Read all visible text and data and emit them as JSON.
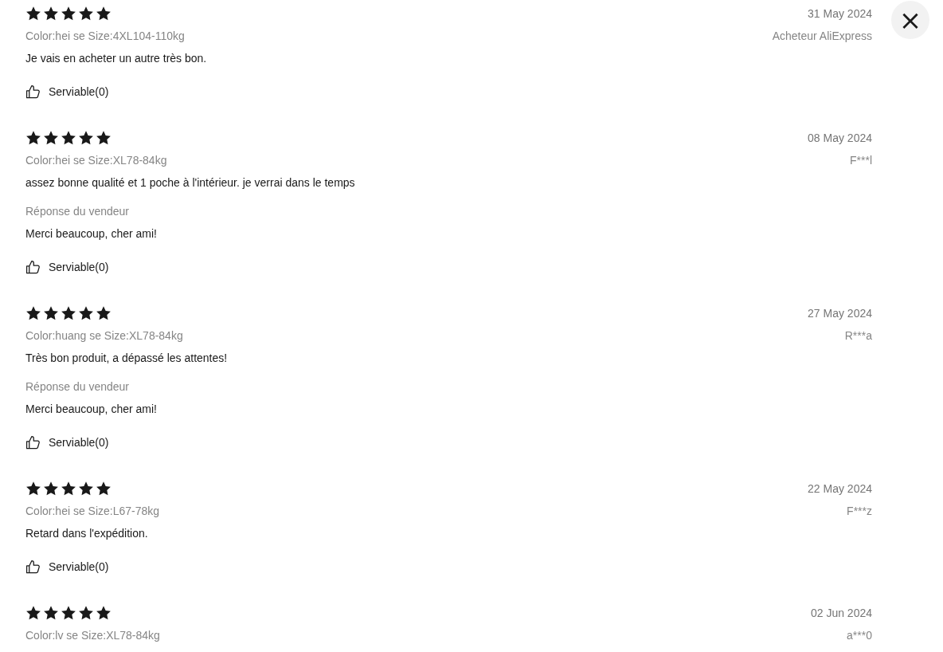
{
  "close_button": {
    "label": "×"
  },
  "reviews": [
    {
      "stars": 5,
      "date": "31 May 2024",
      "variant": "Color:hei se Size:4XL104-110kg",
      "author": "Acheteur AliExpress",
      "text": "Je vais en acheter un autre très bon.",
      "helpful": "Serviable(0)"
    },
    {
      "stars": 5,
      "date": "08 May 2024",
      "variant": "Color:hei se Size:XL78-84kg",
      "author": "F***l",
      "text": "assez bonne qualité et 1 poche à l'intérieur. je verrai dans le temps",
      "seller_reply": {
        "label": "Réponse du vendeur",
        "text": "Merci beaucoup, cher ami!"
      },
      "helpful": "Serviable(0)"
    },
    {
      "stars": 5,
      "date": "27 May 2024",
      "variant": "Color:huang se Size:XL78-84kg",
      "author": "R***a",
      "text": "Très bon produit, a dépassé les attentes!",
      "seller_reply": {
        "label": "Réponse du vendeur",
        "text": "Merci beaucoup, cher ami!"
      },
      "helpful": "Serviable(0)"
    },
    {
      "stars": 5,
      "date": "22 May 2024",
      "variant": "Color:hei se Size:L67-78kg",
      "author": "F***z",
      "text": "Retard dans l'expédition.",
      "helpful": "Serviable(0)"
    },
    {
      "stars": 5,
      "date": "02 Jun 2024",
      "variant": "Color:lv se Size:XL78-84kg",
      "author": "a***0"
    }
  ]
}
